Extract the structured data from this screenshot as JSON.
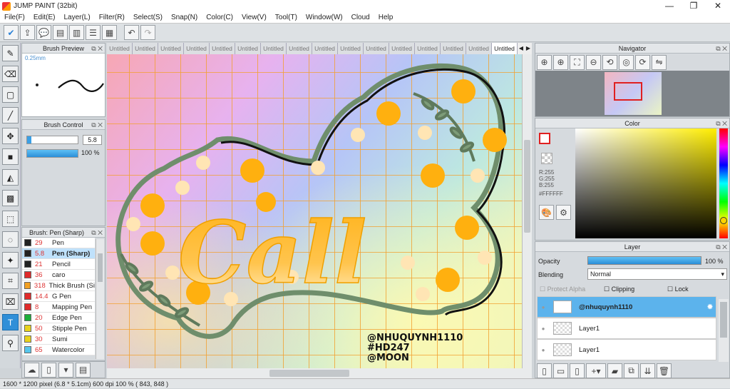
{
  "window": {
    "title": "JUMP PAINT (32bit)",
    "min": "—",
    "max": "❐",
    "close": "✕"
  },
  "menu": [
    "File(F)",
    "Edit(E)",
    "Layer(L)",
    "Filter(R)",
    "Select(S)",
    "Snap(N)",
    "Color(C)",
    "View(V)",
    "Tool(T)",
    "Window(W)",
    "Cloud",
    "Help"
  ],
  "brush_preview": {
    "title": "Brush Preview",
    "size_label": "0.25mm"
  },
  "brush_control": {
    "title": "Brush Control",
    "size_value": "5.8",
    "opacity_value": "100 %",
    "size_fill": 0.08,
    "opacity_fill": 1.0
  },
  "brush_list": {
    "title": "Brush: Pen (Sharp)",
    "items": [
      {
        "size": "29",
        "name": "Pen",
        "color": "#222222"
      },
      {
        "size": "5.8",
        "name": "Pen (Sharp)",
        "color": "#222222"
      },
      {
        "size": "21",
        "name": "Pencil",
        "color": "#222222"
      },
      {
        "size": "36",
        "name": "caro",
        "color": "#e02b2b"
      },
      {
        "size": "318",
        "name": "Thick Brush (Si",
        "color": "#f2a024"
      },
      {
        "size": "14.4",
        "name": "G Pen",
        "color": "#e02b2b"
      },
      {
        "size": "8",
        "name": "Mapping Pen",
        "color": "#e02b2b"
      },
      {
        "size": "20",
        "name": "Edge Pen",
        "color": "#1cae3a"
      },
      {
        "size": "50",
        "name": "Stipple Pen",
        "color": "#e8d21c"
      },
      {
        "size": "30",
        "name": "Sumi",
        "color": "#e8d21c"
      },
      {
        "size": "65",
        "name": "Watercolor",
        "color": "#58c6ec"
      }
    ]
  },
  "tabs": [
    "Untitled",
    "Untitled",
    "Untitled",
    "Untitled",
    "Untitled",
    "Untitled",
    "Untitled",
    "Untitled",
    "Untitled",
    "Untitled",
    "Untitled",
    "Untitled",
    "Untitled",
    "Untitled",
    "Untitled",
    "Untitled"
  ],
  "canvas": {
    "text_lines": [
      "@NHUQUYNH1110",
      "#HD247",
      "@MOON"
    ],
    "lettering": "Call"
  },
  "navigator": {
    "title": "Navigator"
  },
  "color": {
    "title": "Color",
    "r": "R:255",
    "g": "G:255",
    "b": "B:255",
    "hex": "#FFFFFF"
  },
  "layer": {
    "title": "Layer",
    "opacity_label": "Opacity",
    "opacity_value": "100 %",
    "blending_label": "Blending",
    "blending_value": "Normal",
    "protect_alpha": "Protect Alpha",
    "clipping": "Clipping",
    "lock": "Lock",
    "layers": [
      {
        "name": "@nhuquynh1110",
        "selected": true
      },
      {
        "name": "Layer1",
        "selected": false
      },
      {
        "name": "Layer1",
        "selected": false
      }
    ]
  },
  "status": {
    "text": "1600 * 1200 pixel   (6.8 * 5.1cm)   600 dpi   100 %   ( 843, 848 )"
  }
}
